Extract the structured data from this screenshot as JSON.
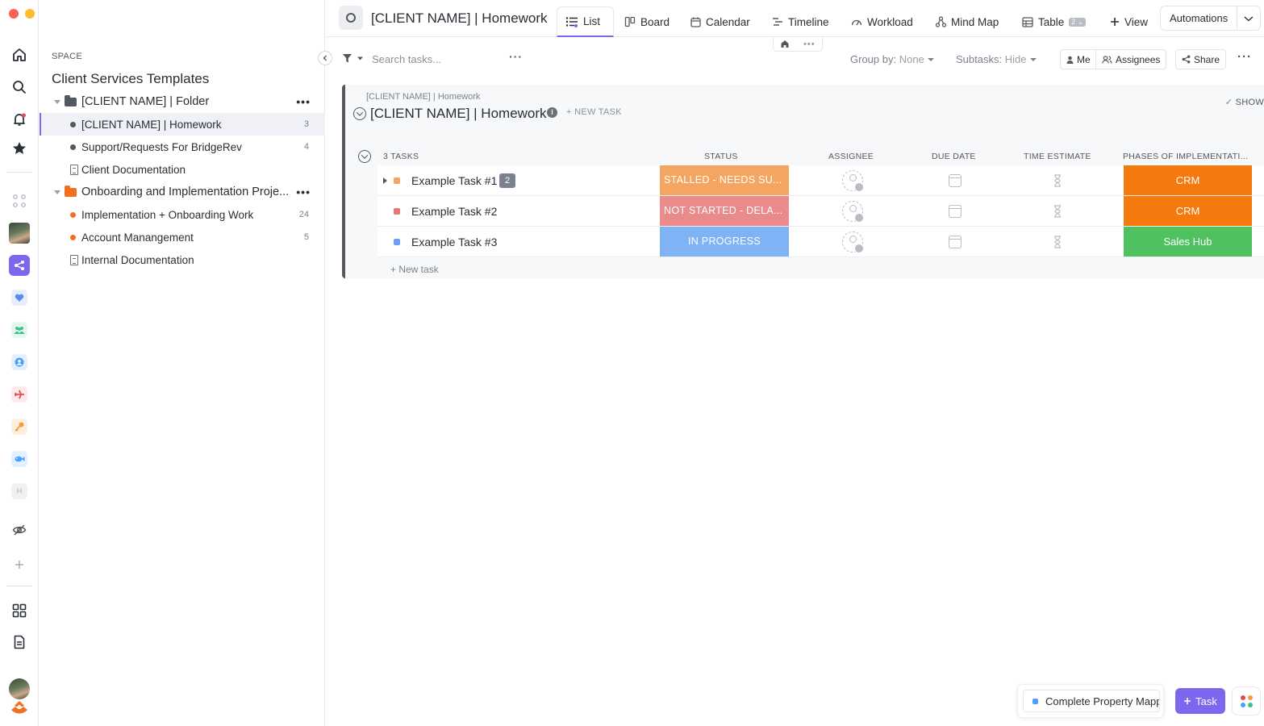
{
  "window": {
    "traffic_lights": [
      "#fe5f57",
      "#febc2e",
      "#28c840"
    ]
  },
  "rail": {
    "items": [
      "home-icon",
      "search-icon",
      "bell-icon",
      "star-icon",
      "apps-grid-icon"
    ],
    "spaces": [
      {
        "icon": "share-icon",
        "color": "#7b68ee"
      },
      {
        "icon": "heart-icon",
        "color": "#5b8def"
      },
      {
        "icon": "people-icon",
        "color": "#3dbf8a"
      },
      {
        "icon": "user-circle-icon",
        "color": "#4a9fff"
      },
      {
        "icon": "plane-icon",
        "color": "#e5485a"
      },
      {
        "icon": "key-icon",
        "color": "#f59a3b"
      },
      {
        "icon": "fish-icon",
        "color": "#4a9fff"
      },
      {
        "icon": "H",
        "color": "#c8ccd4"
      }
    ],
    "bottom": [
      "eye-off-icon",
      "plus-icon",
      "dashboard-icon",
      "docs-icon"
    ]
  },
  "sidebar": {
    "space_label": "SPACE",
    "space_title": "Client Services Templates",
    "tree": [
      {
        "type": "folder",
        "label": "[CLIENT NAME] | Folder",
        "color": "#53575e"
      },
      {
        "type": "list",
        "label": "[CLIENT NAME] | Homework",
        "count": "3",
        "dot": "#53575e",
        "active": true
      },
      {
        "type": "list",
        "label": "Support/Requests For BridgeRev",
        "count": "4",
        "dot": "#53575e"
      },
      {
        "type": "doc",
        "label": "Client Documentation"
      },
      {
        "type": "folder",
        "label": "Onboarding and Implementation Proje...",
        "color": "#f07021"
      },
      {
        "type": "list",
        "label": "Implementation + Onboarding Work",
        "count": "24",
        "dot": "#f07021"
      },
      {
        "type": "list",
        "label": "Account Manangement",
        "count": "5",
        "dot": "#f07021"
      },
      {
        "type": "doc",
        "label": "Internal Documentation"
      }
    ]
  },
  "header": {
    "title": "[CLIENT NAME] | Homework",
    "tabs": [
      {
        "label": "List",
        "icon": "list-icon"
      },
      {
        "label": "Board",
        "icon": "board-icon"
      },
      {
        "label": "Calendar",
        "icon": "calendar-icon"
      },
      {
        "label": "Timeline",
        "icon": "timeline-icon"
      },
      {
        "label": "Workload",
        "icon": "workload-icon"
      },
      {
        "label": "Mind Map",
        "icon": "mindmap-icon"
      },
      {
        "label": "Table",
        "icon": "table-icon",
        "badge": "2"
      }
    ],
    "add_view": "View",
    "automations": "Automations"
  },
  "toolbar": {
    "search_placeholder": "Search tasks...",
    "group_by_label": "Group by:",
    "group_by_value": "None",
    "subtasks_label": "Subtasks:",
    "subtasks_value": "Hide",
    "me": "Me",
    "assignees": "Assignees",
    "share": "Share"
  },
  "list": {
    "breadcrumb": "[CLIENT NAME] | Homework",
    "name": "[CLIENT NAME] | Homework",
    "new_task": "+ NEW TASK",
    "show": "SHOW",
    "task_count": "3 TASKS",
    "columns": [
      "STATUS",
      "ASSIGNEE",
      "DUE DATE",
      "TIME ESTIMATE",
      "PHASES OF IMPLEMENTATI..."
    ],
    "tasks": [
      {
        "name": "Example Task #1",
        "subtasks": "2",
        "status": "STALLED - NEEDS SU...",
        "status_color": "#f4a562",
        "square": "#f4a562",
        "phase": "CRM",
        "phase_color": "#f5790c"
      },
      {
        "name": "Example Task #2",
        "status": "NOT STARTED - DELA...",
        "status_color": "#e98b8b",
        "square": "#e07a7a",
        "phase": "CRM",
        "phase_color": "#f5790c"
      },
      {
        "name": "Example Task #3",
        "status": "IN PROGRESS",
        "status_color": "#7fb3f5",
        "square": "#6d9ff0",
        "phase": "Sales Hub",
        "phase_color": "#4fc25f"
      }
    ],
    "new_task_bottom": "+ New task"
  },
  "tray": {
    "task_name": "Complete Property Mapp",
    "new_task_button": "Task"
  }
}
